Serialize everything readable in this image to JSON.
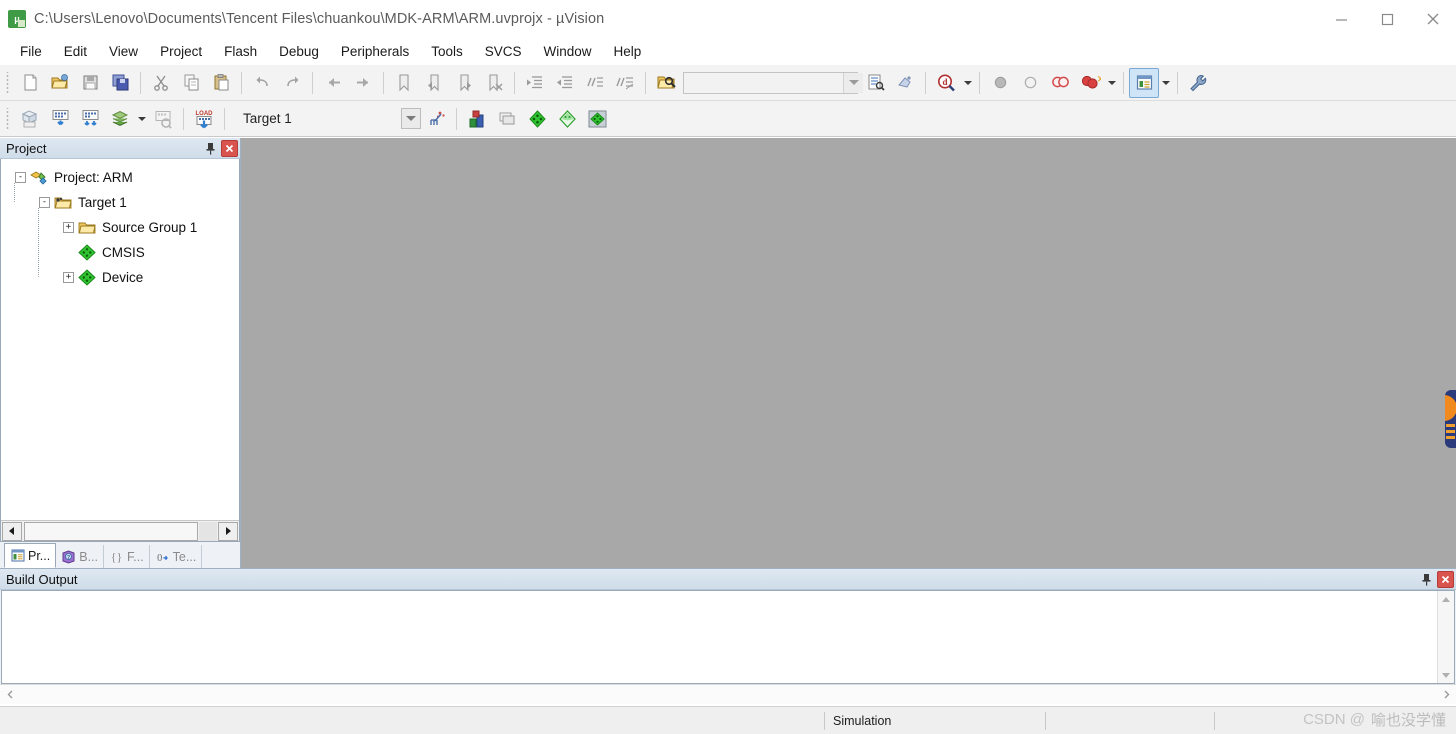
{
  "window": {
    "title": "C:\\Users\\Lenovo\\Documents\\Tencent Files\\chuankou\\MDK-ARM\\ARM.uvprojx - µVision",
    "app_icon": "uvision-logo-icon",
    "controls": {
      "minimize": "minimize-button",
      "maximize": "maximize-button",
      "close": "close-button"
    }
  },
  "menubar": {
    "items": [
      {
        "label": "File"
      },
      {
        "label": "Edit"
      },
      {
        "label": "View"
      },
      {
        "label": "Project"
      },
      {
        "label": "Flash"
      },
      {
        "label": "Debug"
      },
      {
        "label": "Peripherals"
      },
      {
        "label": "Tools"
      },
      {
        "label": "SVCS"
      },
      {
        "label": "Window"
      },
      {
        "label": "Help"
      }
    ]
  },
  "toolbar_file": {
    "buttons": [
      {
        "name": "new-file-icon",
        "tooltip": "New"
      },
      {
        "name": "open-file-icon",
        "tooltip": "Open"
      },
      {
        "name": "save-icon",
        "tooltip": "Save"
      },
      {
        "name": "save-all-icon",
        "tooltip": "Save All"
      },
      {
        "name": "cut-icon",
        "tooltip": "Cut"
      },
      {
        "name": "copy-icon",
        "tooltip": "Copy"
      },
      {
        "name": "paste-icon",
        "tooltip": "Paste"
      },
      {
        "name": "undo-icon",
        "tooltip": "Undo"
      },
      {
        "name": "redo-icon",
        "tooltip": "Redo"
      },
      {
        "name": "navigate-back-icon",
        "tooltip": "Back"
      },
      {
        "name": "navigate-forward-icon",
        "tooltip": "Forward"
      },
      {
        "name": "bookmark-toggle-icon",
        "tooltip": "Insert/Remove Bookmark"
      },
      {
        "name": "bookmark-prev-icon",
        "tooltip": "Previous Bookmark"
      },
      {
        "name": "bookmark-next-icon",
        "tooltip": "Next Bookmark"
      },
      {
        "name": "bookmark-clear-icon",
        "tooltip": "Clear All Bookmarks"
      },
      {
        "name": "indent-icon",
        "tooltip": "Indent Selection"
      },
      {
        "name": "outdent-icon",
        "tooltip": "Outdent Selection"
      },
      {
        "name": "comment-icon",
        "tooltip": "Comment Selection"
      },
      {
        "name": "uncomment-icon",
        "tooltip": "Uncomment Selection"
      },
      {
        "name": "find-in-files-icon",
        "tooltip": "Find in Files"
      }
    ],
    "search": {
      "value": "",
      "placeholder": ""
    },
    "after_search": [
      {
        "name": "incremental-find-icon",
        "tooltip": "Incremental Find"
      },
      {
        "name": "browse-symbol-icon",
        "tooltip": "Browse Symbol"
      }
    ],
    "debug_group": [
      {
        "name": "find-magnifier-icon",
        "tooltip": "Find"
      },
      {
        "name": "breakpoint-insert-icon",
        "tooltip": "Insert/Remove Breakpoint"
      },
      {
        "name": "breakpoint-enable-icon",
        "tooltip": "Enable/Disable Breakpoint"
      },
      {
        "name": "breakpoint-disable-all-icon",
        "tooltip": "Disable All Breakpoints"
      },
      {
        "name": "breakpoint-kill-all-icon",
        "tooltip": "Kill All Breakpoints"
      }
    ],
    "window_manager": {
      "name": "window-manager-icon",
      "active": true
    },
    "configuration": {
      "name": "wrench-configuration-icon",
      "tooltip": "Configuration"
    }
  },
  "toolbar_build": {
    "buttons": [
      {
        "name": "translate-file-icon",
        "tooltip": "Translate Current File"
      },
      {
        "name": "build-target-icon",
        "tooltip": "Build"
      },
      {
        "name": "rebuild-all-icon",
        "tooltip": "Rebuild All Target Files"
      },
      {
        "name": "batch-build-icon",
        "tooltip": "Batch Build"
      },
      {
        "name": "stop-build-icon",
        "tooltip": "Stop Build"
      },
      {
        "name": "download-load-icon",
        "tooltip": "Download"
      }
    ],
    "target": {
      "label": "Target 1",
      "selector_name": "target-selector"
    },
    "after_target": [
      {
        "name": "target-options-wizard-icon",
        "tooltip": "Options for Target"
      },
      {
        "name": "manage-project-items-icon",
        "tooltip": "Manage Project Items"
      },
      {
        "name": "multi-project-icon",
        "tooltip": "Manage Multi-Project"
      },
      {
        "name": "pack-installer-green-icon",
        "tooltip": "Pack Installer"
      },
      {
        "name": "manage-runtime-env-icon",
        "tooltip": "Manage Run-Time Environment"
      },
      {
        "name": "select-software-packs-icon",
        "tooltip": "Select Software Packs"
      }
    ]
  },
  "project_panel": {
    "title": "Project",
    "pin": "pin-icon",
    "close": "close-icon",
    "tree": [
      {
        "label": "Project: ARM",
        "level": 0,
        "expander": "-",
        "icon": "project-icon"
      },
      {
        "label": "Target 1",
        "level": 1,
        "expander": "-",
        "icon": "target-folder-icon"
      },
      {
        "label": "Source Group 1",
        "level": 2,
        "expander": "+",
        "icon": "folder-icon"
      },
      {
        "label": "CMSIS",
        "level": 2,
        "expander": "",
        "icon": "component-diamond-icon"
      },
      {
        "label": "Device",
        "level": 2,
        "expander": "+",
        "icon": "component-diamond-icon"
      }
    ],
    "tabs": [
      {
        "label": "Pr...",
        "icon": "project-tab-icon",
        "active": true,
        "name": "tab-project"
      },
      {
        "label": "B...",
        "icon": "books-tab-icon",
        "active": false,
        "name": "tab-books"
      },
      {
        "label": "F...",
        "icon": "functions-tab-icon",
        "active": false,
        "name": "tab-functions"
      },
      {
        "label": "Te...",
        "icon": "templates-tab-icon",
        "active": false,
        "name": "tab-templates"
      }
    ]
  },
  "build_output": {
    "title": "Build Output",
    "pin": "pin-icon",
    "close": "close-icon",
    "content": ""
  },
  "statusbar": {
    "left": "",
    "simulation": "Simulation",
    "cell3": "",
    "cell4": ""
  },
  "watermark": {
    "prefix": "CSDN @",
    "author": "喻也没学懂"
  },
  "colors": {
    "editor_background": "#a8a8a8",
    "panel_background": "#eef2f6",
    "caption_gradient_top": "#dfe8f1",
    "close_red": "#d9534f",
    "active_toolbar_blue": "#cfe4f7",
    "component_green": "#22bb22"
  }
}
